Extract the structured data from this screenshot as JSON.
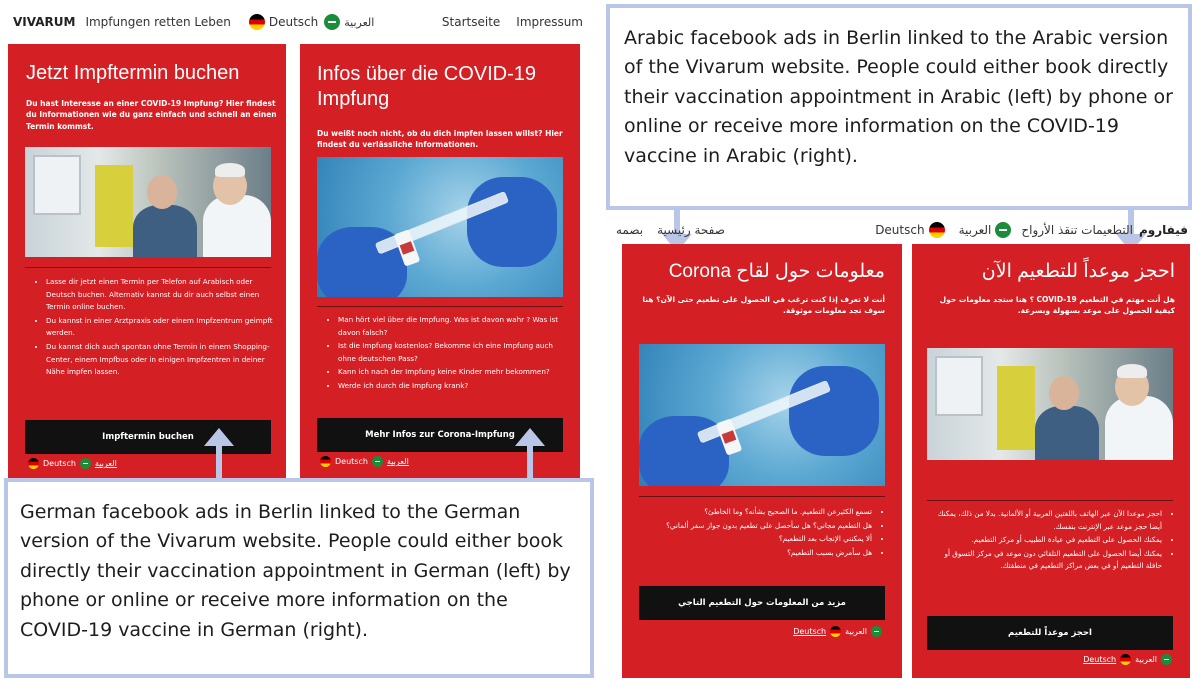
{
  "german_site": {
    "nav": {
      "brand": "VIVARUM",
      "tagline": "Impfungen retten Leben",
      "lang_de": "Deutsch",
      "lang_ar": "العربية",
      "link_home": "Startseite",
      "link_imprint": "Impressum"
    },
    "card_left": {
      "title": "Jetzt Impftermin buchen",
      "intro": "Du hast Interesse an einer COVID-19 Impfung? Hier findest du Informationen wie du ganz einfach und schnell an einen Termin kommst.",
      "bullets": [
        "Lasse dir jetzt einen Termin per Telefon auf Arabisch oder Deutsch buchen. Alternativ kannst du dir auch selbst einen Termin online buchen.",
        "Du kannst in einer Arztpraxis oder einem Impfzentrum geimpft werden.",
        "Du kannst dich auch spontan ohne Termin in einem Shopping-Center, einem Impfbus oder in einigen Impfzentren in deiner Nähe impfen lassen."
      ],
      "cta": "Impftermin buchen",
      "lang_de": "Deutsch",
      "lang_ar": "العربية"
    },
    "card_right": {
      "title": "Infos über die COVID-19 Impfung",
      "intro": "Du weißt noch nicht, ob du dich impfen lassen willst? Hier findest du verlässliche Informationen.",
      "bullets": [
        "Man hört viel über die Impfung. Was ist davon wahr ? Was ist davon falsch?",
        "Ist die Impfung kostenlos? Bekomme ich eine Impfung auch ohne deutschen Pass?",
        "Kann ich nach der Impfung keine Kinder mehr bekommen?",
        "Werde ich durch die Impfung krank?"
      ],
      "cta": "Mehr Infos zur Corona-Impfung",
      "lang_de": "Deutsch",
      "lang_ar": "العربية"
    }
  },
  "arabic_site": {
    "nav": {
      "brand": "فيفاروم",
      "tagline": "التطعيمات تنقذ الأرواح",
      "lang_ar": "العربية",
      "lang_de": "Deutsch",
      "link_home": "صفحة رئيسية",
      "link_imprint": "بصمه"
    },
    "card_right": {
      "title": "احجز موعداً للتطعيم الآن",
      "intro": "هل أنت مهتم في التطعيم COVID-19 ؟ هنا ستجد معلومات حول كيفية الحصول على موعد بسهولة وبسرعة.",
      "bullets": [
        "احجز موعدا الآن عبر الهاتف باللغتين العربية أو الألمانية. بدلا من ذلك، يمكنك أيضا حجز موعد عبر الإنترنت بنفسك.",
        "يمكنك الحصول على التطعيم في عيادة الطبيب أو مركز التطعيم.",
        "يمكنك أيضا الحصول على التطعيم التلقائي دون موعد في مركز التسوق أو حافلة التطعيم أو في بعض مراكز التطعيم في منطقتك."
      ],
      "cta": "احجز موعداً للتطعيم",
      "lang_ar": "العربية",
      "lang_de": "Deutsch"
    },
    "card_left": {
      "title": "معلومات حول لقاح Corona",
      "intro": "أنت لا تعرف إذا كنت ترغب في الحصول على تطعيم حتى الآن؟ هنا سوف تجد معلومات موثوقة.",
      "bullets": [
        "تسمع الكثيرعن التطعيم. ما الصحيح بشأنه؟ وما الخاطئ؟",
        "هل التطعيم مجاني؟ هل سأحصل على تطعيم بدون جواز سفر ألماني؟",
        "ألا يمكنني الإنجاب بعد التطعيم؟",
        "هل سأمرض بسبب التطعيم؟"
      ],
      "cta": "مزيد من المعلومات حول التطعيم التاجي",
      "lang_ar": "العربية",
      "lang_de": "Deutsch"
    }
  },
  "captions": {
    "arabic": "Arabic facebook ads in Berlin linked to the Arabic version of the Vivarum website. People could either book directly their vaccination appointment in Arabic (left) by phone or online or receive more information on the COVID-19 vaccine in Arabic (right).",
    "german": "German facebook ads in Berlin linked to the German version of the Vivarum website. People could either book directly their vaccination appointment in German (left) by phone or online or receive more information on the COVID-19 vaccine in German (right)."
  },
  "icons": {
    "flag_de": "germany-flag-icon",
    "flag_sa": "saudi-flag-icon",
    "arrow": "arrow-up-icon"
  },
  "colors": {
    "card_red": "#d42025",
    "cta_black": "#111111",
    "callout_border": "#b9c6e6"
  }
}
